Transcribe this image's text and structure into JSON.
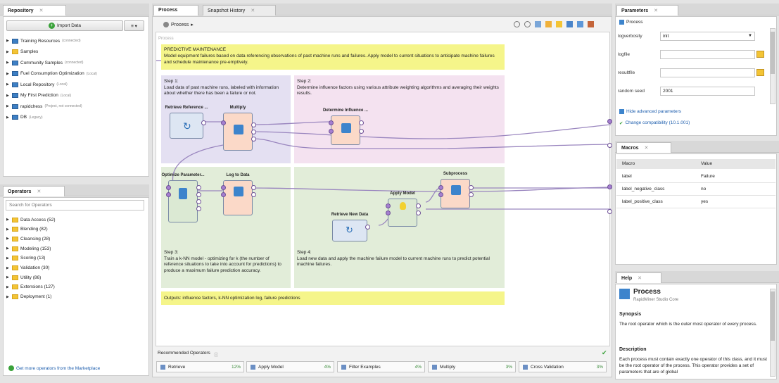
{
  "repository": {
    "tab": "Repository",
    "import_button": "Import Data",
    "menu_button": "≡ ▾",
    "items": [
      {
        "label": "Training Resources",
        "note": "(connected)",
        "icon": "training-icon"
      },
      {
        "label": "Samples",
        "note": "",
        "icon": "folder-icon"
      },
      {
        "label": "Community Samples",
        "note": "(connected)",
        "icon": "community-icon"
      },
      {
        "label": "Fuel Consumption Optimization",
        "note": "(Local)",
        "icon": "repo-icon"
      },
      {
        "label": "Local Repository",
        "note": "(Local)",
        "icon": "repo-icon"
      },
      {
        "label": "My First Prediction",
        "note": "(Local)",
        "icon": "repo-icon"
      },
      {
        "label": "rapidchess",
        "note": "(Project, not connected)",
        "icon": "project-icon"
      },
      {
        "label": "DB",
        "note": "(Legacy)",
        "icon": "db-icon"
      }
    ]
  },
  "operators": {
    "tab": "Operators",
    "search_placeholder": "Search for Operators",
    "items": [
      "Data Access (52)",
      "Blending (82)",
      "Cleansing (28)",
      "Modeling (153)",
      "Scoring (13)",
      "Validation (30)",
      "Utility (86)",
      "Extensions (127)",
      "Deployment (1)"
    ],
    "marketplace_link": "Get more operators from the Marketplace"
  },
  "process": {
    "tabs": [
      "Process",
      "Snapshot History"
    ],
    "breadcrumb": "Process",
    "breadcrumb_arrow": "▸",
    "canvas_label": "Process",
    "header_note_title": "PREDICTIVE MAINTENANCE",
    "header_note_text": "Model equipment failures based on data referencing observations of past machine runs and failures. Apply model to current situations to anticipate machine failures and schedule maintenance pre-emptively.",
    "step1": "Step 1:\nLoad data of past machine runs, labeled with information about whether there has been a failure or not.",
    "step2": "Step 2:\nDetermine influence factors using various attribute weighting algorithms and averaging their weights results.",
    "step3": "Step 3:\nTrain a k-NN model - optimizing for k (the number of reference situations to take into account for predictions) to produce a maximum failure prediction accuracy.",
    "step4": "Step 4:\nLoad new data and apply the machine failure model to current machine runs to predict potential machine failures.",
    "footer_note": "Outputs: influence factors, k-NN optimization log, failure predictions",
    "operators": {
      "retrieve_ref": "Retrieve Reference ...",
      "multiply": "Multiply",
      "determine": "Determine Influence ...",
      "optimize": "Optimize Parameter...",
      "log_to_data": "Log to Data",
      "subprocess": "Subprocess",
      "apply_model": "Apply Model",
      "retrieve_new": "Retrieve New Data"
    },
    "port_labels": {
      "out": "out",
      "inp": "inp",
      "in": "in",
      "exa": "exa",
      "res": "res",
      "par": "par",
      "per": "per",
      "thr": "thr",
      "mod": "mod",
      "unl": "unl",
      "lab": "lab",
      "exa_s": "exa"
    }
  },
  "recommended": {
    "title": "Recommended Operators",
    "items": [
      {
        "label": "Retrieve",
        "pct": "12%",
        "icon": "retrieve-icon"
      },
      {
        "label": "Apply Model",
        "pct": "4%",
        "icon": "bulb-icon"
      },
      {
        "label": "Filter Examples",
        "pct": "4%",
        "icon": "filter-icon"
      },
      {
        "label": "Multiply",
        "pct": "3%",
        "icon": "multiply-icon"
      },
      {
        "label": "Cross Validation",
        "pct": "3%",
        "icon": "validation-icon"
      }
    ]
  },
  "parameters": {
    "tab": "Parameters",
    "context": "Process",
    "rows": [
      {
        "key": "logverbosity",
        "value": "init"
      },
      {
        "key": "logfile",
        "value": ""
      },
      {
        "key": "resultfile",
        "value": ""
      },
      {
        "key": "random seed",
        "value": "2001"
      }
    ],
    "hide_advanced": "Hide advanced parameters",
    "compat": "Change compatibility (10.1.001)"
  },
  "macros": {
    "tab": "Macros",
    "headers": [
      "Macro",
      "Value"
    ],
    "rows": [
      [
        "label",
        "Failure"
      ],
      [
        "label_negative_class",
        "no"
      ],
      [
        "label_positive_class",
        "yes"
      ]
    ]
  },
  "help": {
    "tab": "Help",
    "title": "Process",
    "subtitle": "RapidMiner Studio Core",
    "synopsis_h": "Synopsis",
    "synopsis": "The root operator which is the outer most operator of every process.",
    "description_h": "Description",
    "description": "Each process must contain exactly one operator of this class, and it must be the root operator of the process. This operator provides a set of parameters that are of global"
  },
  "colors": {
    "note_yellow": "#f5f58a",
    "step_purple": "#e4e0f2",
    "step_pink": "#f4e2f0",
    "step_green": "#e2edd9",
    "op_blue": "#dde6f3",
    "op_peach": "#fbd9c8",
    "op_green": "#dbe9d3",
    "port": "#a57fd0"
  }
}
